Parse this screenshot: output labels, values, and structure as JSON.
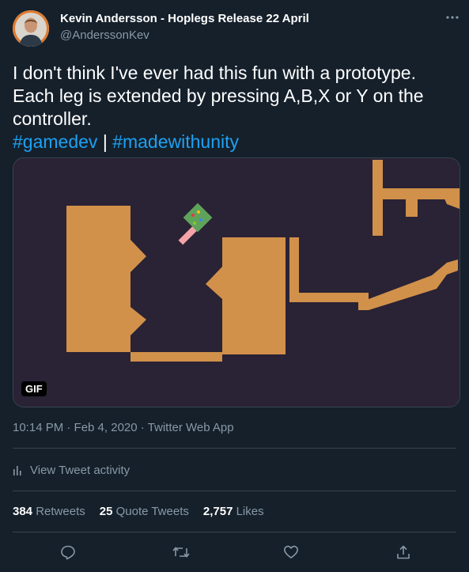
{
  "author": {
    "name": "Kevin Andersson - Hoplegs Release 22 April",
    "handle": "@AnderssonKev"
  },
  "tweet": {
    "text": "I don't think I've ever had this fun with a prototype. Each leg is extended by pressing A,B,X or Y on the controller.",
    "hashtags": [
      "#gamedev",
      "#madewithunity"
    ],
    "hashtag_separator": "|",
    "media_badge": "GIF",
    "meta": "10:14 PM · Feb 4, 2020 · Twitter Web App"
  },
  "activity_label": "View Tweet activity",
  "stats": {
    "retweets_count": "384",
    "retweets_label": "Retweets",
    "quote_count": "25",
    "quote_label": "Quote Tweets",
    "likes_count": "2,757",
    "likes_label": "Likes"
  },
  "actions": [
    "reply-icon",
    "retweet-icon",
    "like-icon",
    "share-icon"
  ],
  "colors": {
    "background": "#15202b",
    "link": "#1da1f2",
    "secondary_text": "#8899a6",
    "border": "#38444d",
    "game_background": "#2a2235",
    "game_walls": "#d1914a",
    "player_body": "#5fa35a",
    "player_leg": "#f4a3a8"
  }
}
